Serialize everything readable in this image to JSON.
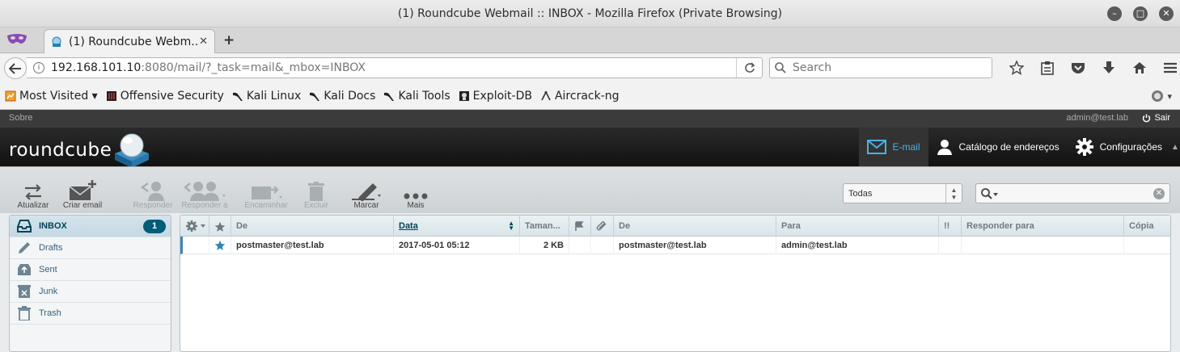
{
  "window": {
    "title": "(1) Roundcube Webmail :: INBOX - Mozilla Firefox (Private Browsing)",
    "controls": [
      "minimize",
      "maximize",
      "close"
    ]
  },
  "tab": {
    "title": "(1) Roundcube Webm...",
    "close_label": "✕"
  },
  "newtab_label": "+",
  "url": {
    "host": "192.168.101.10",
    "rest": ":8080/mail/?_task=mail&_mbox=INBOX"
  },
  "browser_search": {
    "placeholder": "Search"
  },
  "bookmarks": [
    {
      "label": "Most Visited ▾",
      "icon": "most-visited-icon"
    },
    {
      "label": "Offensive Security",
      "icon": "offsec-icon"
    },
    {
      "label": "Kali Linux",
      "icon": "kali-dragon-icon"
    },
    {
      "label": "Kali Docs",
      "icon": "kali-dragon-icon"
    },
    {
      "label": "Kali Tools",
      "icon": "kali-dragon-icon"
    },
    {
      "label": "Exploit-DB",
      "icon": "exploit-db-icon"
    },
    {
      "label": "Aircrack-ng",
      "icon": "aircrack-icon"
    }
  ],
  "rc": {
    "about": "Sobre",
    "user": "admin@test.lab",
    "logout": "Sair",
    "logo_text": "roundcube",
    "nav": {
      "email": "E-mail",
      "contacts": "Catálogo de endereços",
      "settings": "Configurações"
    },
    "toolbar": {
      "refresh": "Atualizar",
      "compose": "Criar email",
      "reply": "Responder",
      "reply_all": "Responder a",
      "forward": "Encaminhar",
      "delete": "Excluir",
      "mark": "Marcar",
      "more": "Mais"
    },
    "filter": {
      "selected": "Todas"
    },
    "search": {
      "value": ""
    }
  },
  "folders": [
    {
      "name": "INBOX",
      "icon": "inbox-icon",
      "unread": "1",
      "selected": true
    },
    {
      "name": "Drafts",
      "icon": "pencil-icon",
      "unread": "",
      "selected": false
    },
    {
      "name": "Sent",
      "icon": "sent-icon",
      "unread": "",
      "selected": false
    },
    {
      "name": "Junk",
      "icon": "junk-icon",
      "unread": "",
      "selected": false
    },
    {
      "name": "Trash",
      "icon": "trash-icon",
      "unread": "",
      "selected": false
    }
  ],
  "messages": {
    "columns": {
      "from": "De",
      "date": "Data",
      "size": "Taman...",
      "from2": "De",
      "to": "Para",
      "priority": "!!",
      "replyto": "Responder para",
      "cc": "Cópia"
    },
    "rows": [
      {
        "from": "postmaster@test.lab",
        "date": "2017-05-01 05:12",
        "size": "2 KB",
        "from2": "postmaster@test.lab",
        "to": "admin@test.lab",
        "replyto": "",
        "cc": "",
        "flagged": true
      }
    ]
  },
  "colors": {
    "accent": "#37a6d8",
    "badge": "#005d76",
    "header": "#1c1c1c"
  }
}
